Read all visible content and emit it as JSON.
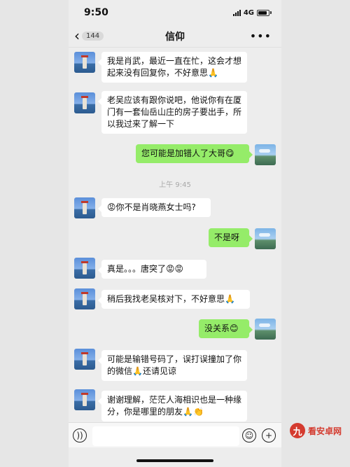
{
  "status_bar": {
    "time": "9:50",
    "network": "4G"
  },
  "nav": {
    "unread_count": "144",
    "title": "信仰"
  },
  "messages": [
    {
      "side": "in",
      "text": "我是肖武，最近一直在忙，这会才想起来没有回复你，不好意思🙏"
    },
    {
      "side": "in",
      "text": "老吴应该有跟你说吧，他说你有在厦门有一套仙岳山庄的房子要出手，所以我过来了解一下"
    },
    {
      "side": "out",
      "text": "您可能是加错人了大哥😋"
    },
    {
      "side": "in",
      "text": "😡你不是肖晓燕女士吗?"
    },
    {
      "side": "out",
      "text": "不是呀"
    },
    {
      "side": "in",
      "text": "真是。。。唐突了😡😡"
    },
    {
      "side": "in",
      "text": "稍后我找老吴核对下，不好意思🙏"
    },
    {
      "side": "out",
      "text": "没关系😊"
    },
    {
      "side": "in",
      "text": "可能是输错号码了，误打误撞加了你的微信🙏还请见谅"
    },
    {
      "side": "in",
      "text": "谢谢理解，茫茫人海相识也是一种缘分，你是哪里的朋友🙏👏"
    }
  ],
  "timestamp": "上午 9:45",
  "input_bar": {
    "voice_icon": "voice-icon",
    "emoji_icon": "emoji-icon",
    "plus_icon": "plus-icon"
  },
  "watermark": {
    "logo_char": "九",
    "text": "看安卓网"
  },
  "colors": {
    "self_bubble": "#95ec69",
    "other_bubble": "#ffffff",
    "background": "#ededed"
  }
}
